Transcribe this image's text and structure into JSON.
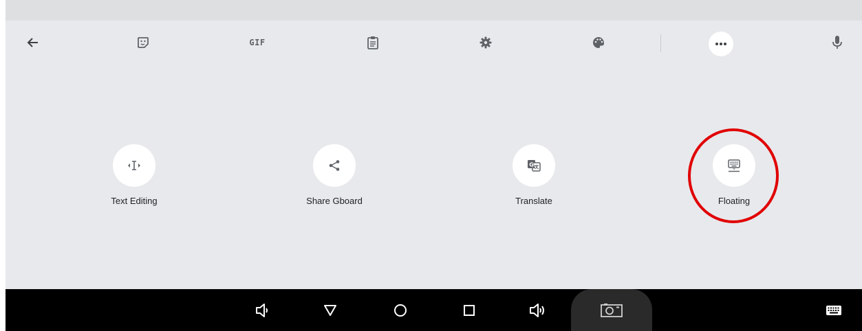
{
  "toolbar": {
    "back_icon": "arrow-left-icon",
    "sticker_icon": "sticker-icon",
    "gif_label": "GIF",
    "clipboard_icon": "clipboard-icon",
    "settings_icon": "gear-icon",
    "theme_icon": "palette-icon",
    "more_icon": "more-horizontal-icon",
    "voice_icon": "microphone-icon"
  },
  "features": [
    {
      "label": "Text Editing",
      "icon": "text-cursor-icon"
    },
    {
      "label": "Share Gboard",
      "icon": "share-icon"
    },
    {
      "label": "Translate",
      "icon": "translate-icon"
    },
    {
      "label": "Floating",
      "icon": "floating-keyboard-icon"
    }
  ],
  "navbar": {
    "buttons": [
      "volume-down-icon",
      "back-triangle-icon",
      "home-circle-icon",
      "recents-square-icon",
      "volume-up-icon",
      "screenshot-icon",
      "keyboard-icon"
    ]
  },
  "colors": {
    "keyboard_bg": "#e8e9ec",
    "icon_gray": "#5f6368",
    "highlight_red": "#e00000",
    "navbar_bg": "#000000"
  }
}
